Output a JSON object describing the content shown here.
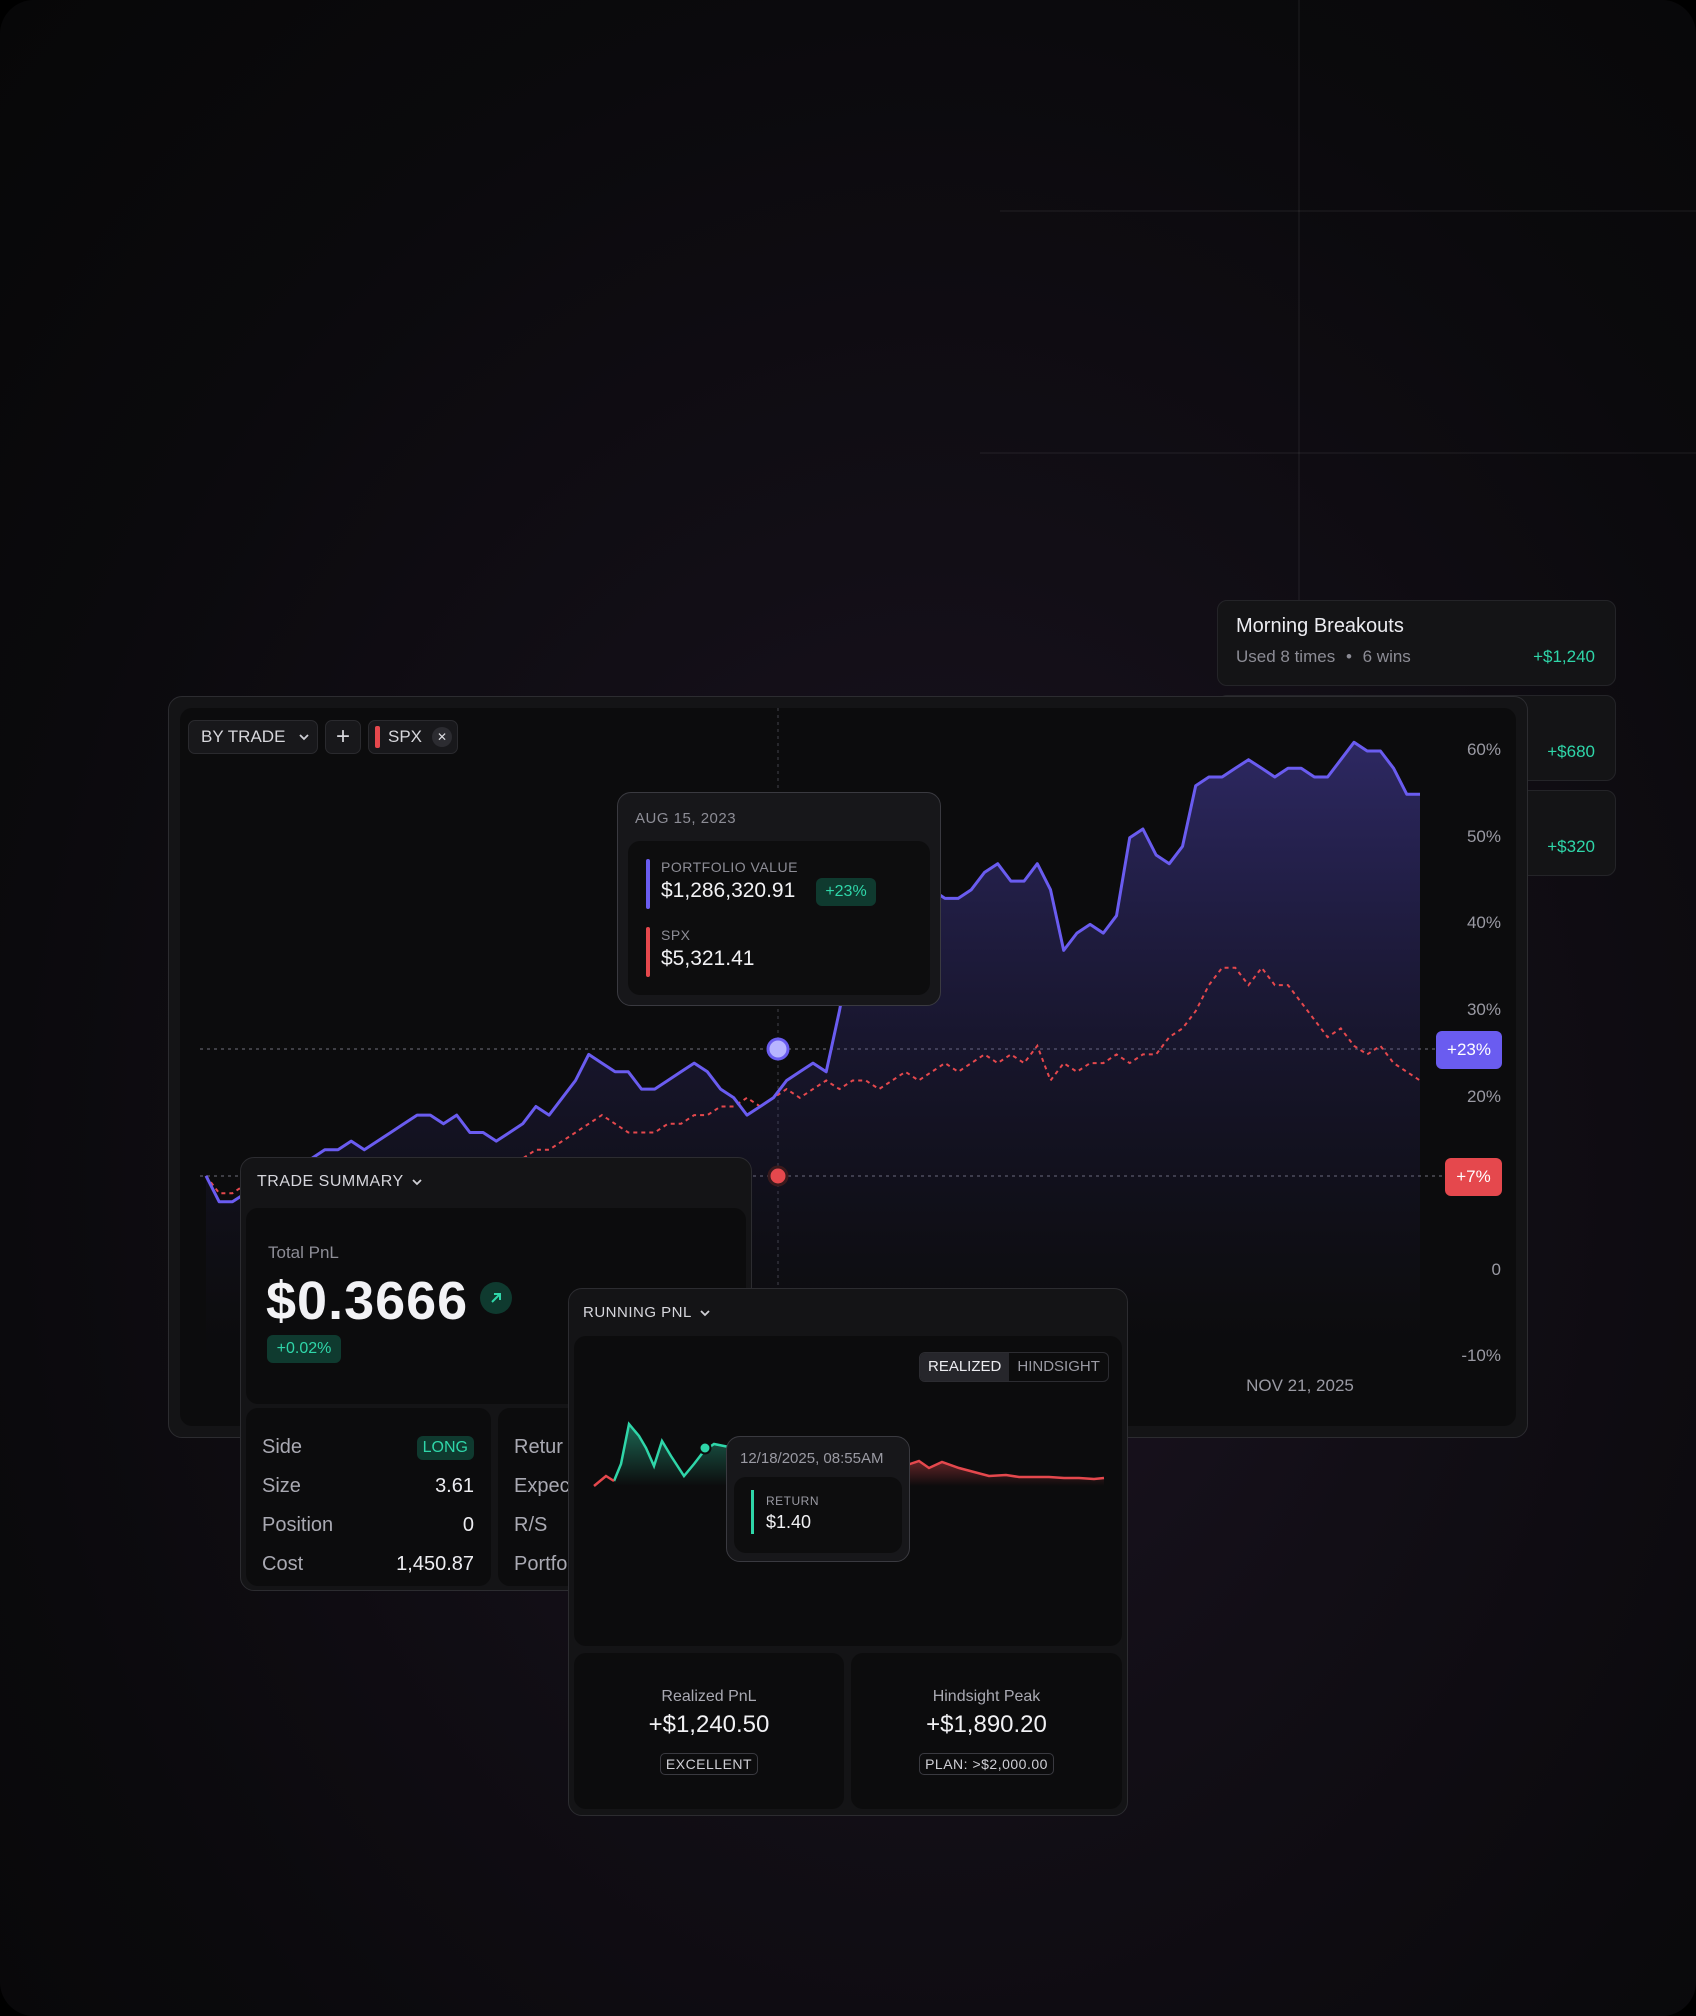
{
  "strategies": [
    {
      "name": "Morning Breakouts",
      "meta": "Used 8 times",
      "meta2": "6 wins",
      "pnl": "+$1,240"
    },
    {
      "pnl": "+$680"
    },
    {
      "pnl": "+$320"
    }
  ],
  "main_chart": {
    "mode_label": "BY TRADE",
    "add_label": "+",
    "compare_ticker": "SPX",
    "close_glyph": "✕",
    "y_ticks": [
      "60%",
      "50%",
      "40%",
      "30%",
      "20%",
      "0",
      "-10%"
    ],
    "x_tick": "NOV 21, 2025",
    "portfolio_badge": "+23%",
    "spx_badge": "+7%",
    "colors": {
      "portfolio": "#6a5cf0",
      "spx": "#e5484d",
      "positive": "#2fd6a9"
    },
    "tooltip": {
      "date": "AUG 15, 2023",
      "portfolio_label": "PORTFOLIO VALUE",
      "portfolio_value": "$1,286,320.91",
      "portfolio_change": "+23%",
      "spx_label": "SPX",
      "spx_value": "$5,321.41"
    }
  },
  "chart_data": {
    "type": "area",
    "y_unit": "%",
    "ylim": [
      -10,
      60
    ],
    "series": [
      {
        "name": "PORTFOLIO VALUE",
        "values": [
          11,
          8,
          8,
          9,
          10,
          10,
          11,
          12,
          13,
          14,
          14,
          15,
          14,
          15,
          16,
          17,
          18,
          18,
          17,
          18,
          16,
          16,
          15,
          16,
          17,
          19,
          18,
          20,
          22,
          25,
          24,
          23,
          23,
          21,
          21,
          22,
          23,
          24,
          23,
          21,
          20,
          18,
          19,
          20,
          22,
          23,
          24,
          23,
          30,
          38,
          42,
          44,
          45,
          47,
          46,
          44,
          43,
          43,
          44,
          46,
          47,
          45,
          45,
          47,
          44,
          37,
          39,
          40,
          39,
          41,
          50,
          51,
          48,
          47,
          49,
          56,
          57,
          57,
          58,
          59,
          58,
          57,
          58,
          58,
          57,
          57,
          59,
          61,
          60,
          60,
          58,
          55,
          55
        ]
      },
      {
        "name": "SPX",
        "values": [
          11,
          9,
          9,
          10,
          10,
          11,
          11,
          11,
          11,
          12,
          12,
          11,
          12,
          13,
          13,
          13,
          12,
          12,
          12,
          12,
          12,
          11,
          11,
          12,
          13,
          14,
          14,
          15,
          16,
          17,
          18,
          17,
          16,
          16,
          16,
          17,
          17,
          18,
          18,
          19,
          19,
          20,
          19,
          20,
          21,
          20,
          21,
          22,
          21,
          22,
          22,
          21,
          22,
          23,
          22,
          23,
          24,
          23,
          24,
          25,
          24,
          25,
          24,
          26,
          22,
          24,
          23,
          24,
          24,
          25,
          24,
          25,
          25,
          27,
          28,
          30,
          33,
          35,
          35,
          33,
          35,
          33,
          33,
          31,
          29,
          27,
          28,
          26,
          25,
          26,
          24,
          23,
          22
        ]
      }
    ]
  },
  "trade_summary": {
    "title": "TRADE SUMMARY",
    "total_label": "Total PnL",
    "total_value": "$0.3666",
    "change": "+0.02%",
    "rows_left": [
      {
        "label": "Side",
        "value": "LONG"
      },
      {
        "label": "Size",
        "value": "3.61"
      },
      {
        "label": "Position",
        "value": "0"
      },
      {
        "label": "Cost",
        "value": "1,450.87"
      }
    ],
    "rows_right": [
      {
        "label": "Retur"
      },
      {
        "label": "Expec"
      },
      {
        "label": "R/S"
      },
      {
        "label": "Portfo"
      }
    ]
  },
  "running_pnl": {
    "title": "RUNNING PNL",
    "toggle": [
      "REALIZED",
      "HINDSIGHT"
    ],
    "tooltip": {
      "date": "12/18/2025, 08:55AM",
      "label": "RETURN",
      "value": "$1.40"
    },
    "realized": {
      "label": "Realized PnL",
      "value": "+$1,240.50",
      "badge": "EXCELLENT"
    },
    "hindsight": {
      "label": "Hindsight Peak",
      "value": "+$1,890.20",
      "badge": "PLAN: >$2,000.00"
    }
  }
}
